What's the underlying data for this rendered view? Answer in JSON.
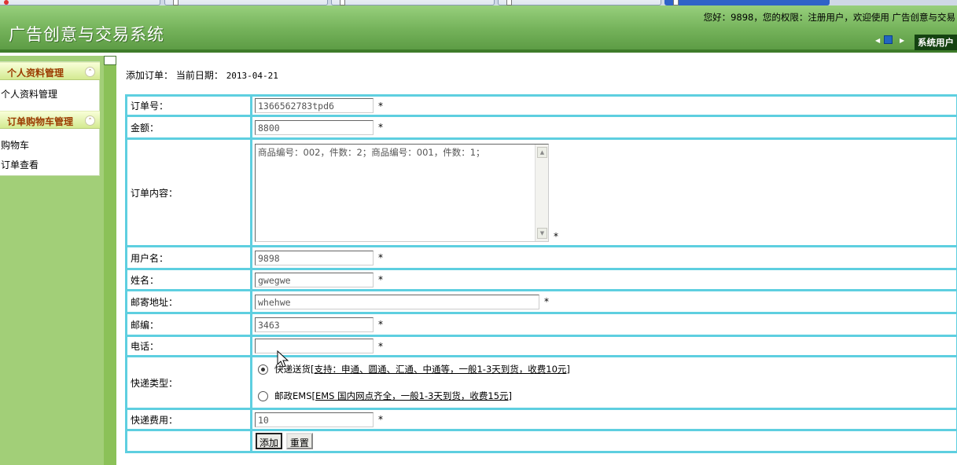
{
  "header": {
    "app_title": "广告创意与交易系统",
    "welcome": "您好：9898，您的权限：注册用户，欢迎使用 广告创意与交易",
    "nav_tab": "系统用户"
  },
  "sidebar": {
    "sections": [
      {
        "title": "个人资料管理",
        "items": [
          "个人资料管理"
        ]
      },
      {
        "title": "订单购物车管理",
        "items": [
          "购物车",
          "订单查看"
        ]
      }
    ]
  },
  "main": {
    "heading_label": "添加订单：",
    "date_label": "当前日期：",
    "date_value": "2013-04-21"
  },
  "form": {
    "order_no": {
      "label": "订单号：",
      "value": "1366562783tpd6"
    },
    "amount": {
      "label": "金额：",
      "value": "8800"
    },
    "content": {
      "label": "订单内容：",
      "value": "商品编号：002，件数：2；商品编号：001，件数：1；"
    },
    "username": {
      "label": "用户名：",
      "value": "9898"
    },
    "name": {
      "label": "姓名：",
      "value": "gwegwe"
    },
    "address": {
      "label": "邮寄地址：",
      "value": "whehwe"
    },
    "postcode": {
      "label": "邮编：",
      "value": "3463"
    },
    "phone": {
      "label": "电话：",
      "value": ""
    },
    "shipping_type": {
      "label": "快递类型：",
      "options": [
        {
          "prefix": "快递送货",
          "detail": "[支持：申通、圆通、汇通、中通等，一般1-3天到货，收费10元]",
          "checked": true
        },
        {
          "prefix": "邮政EMS",
          "detail": "[EMS 国内网点齐全，一般1-3天到货，收费15元]",
          "checked": false
        }
      ]
    },
    "shipping_fee": {
      "label": "快递费用：",
      "value": "10"
    },
    "required_mark": "*",
    "buttons": {
      "add": "添加",
      "reset": "重置"
    }
  },
  "colors": {
    "header_green": "#74b25a",
    "sidebar_green": "#a2cf78",
    "menu_title": "#9b3b00",
    "table_border": "#5ecfe0"
  }
}
